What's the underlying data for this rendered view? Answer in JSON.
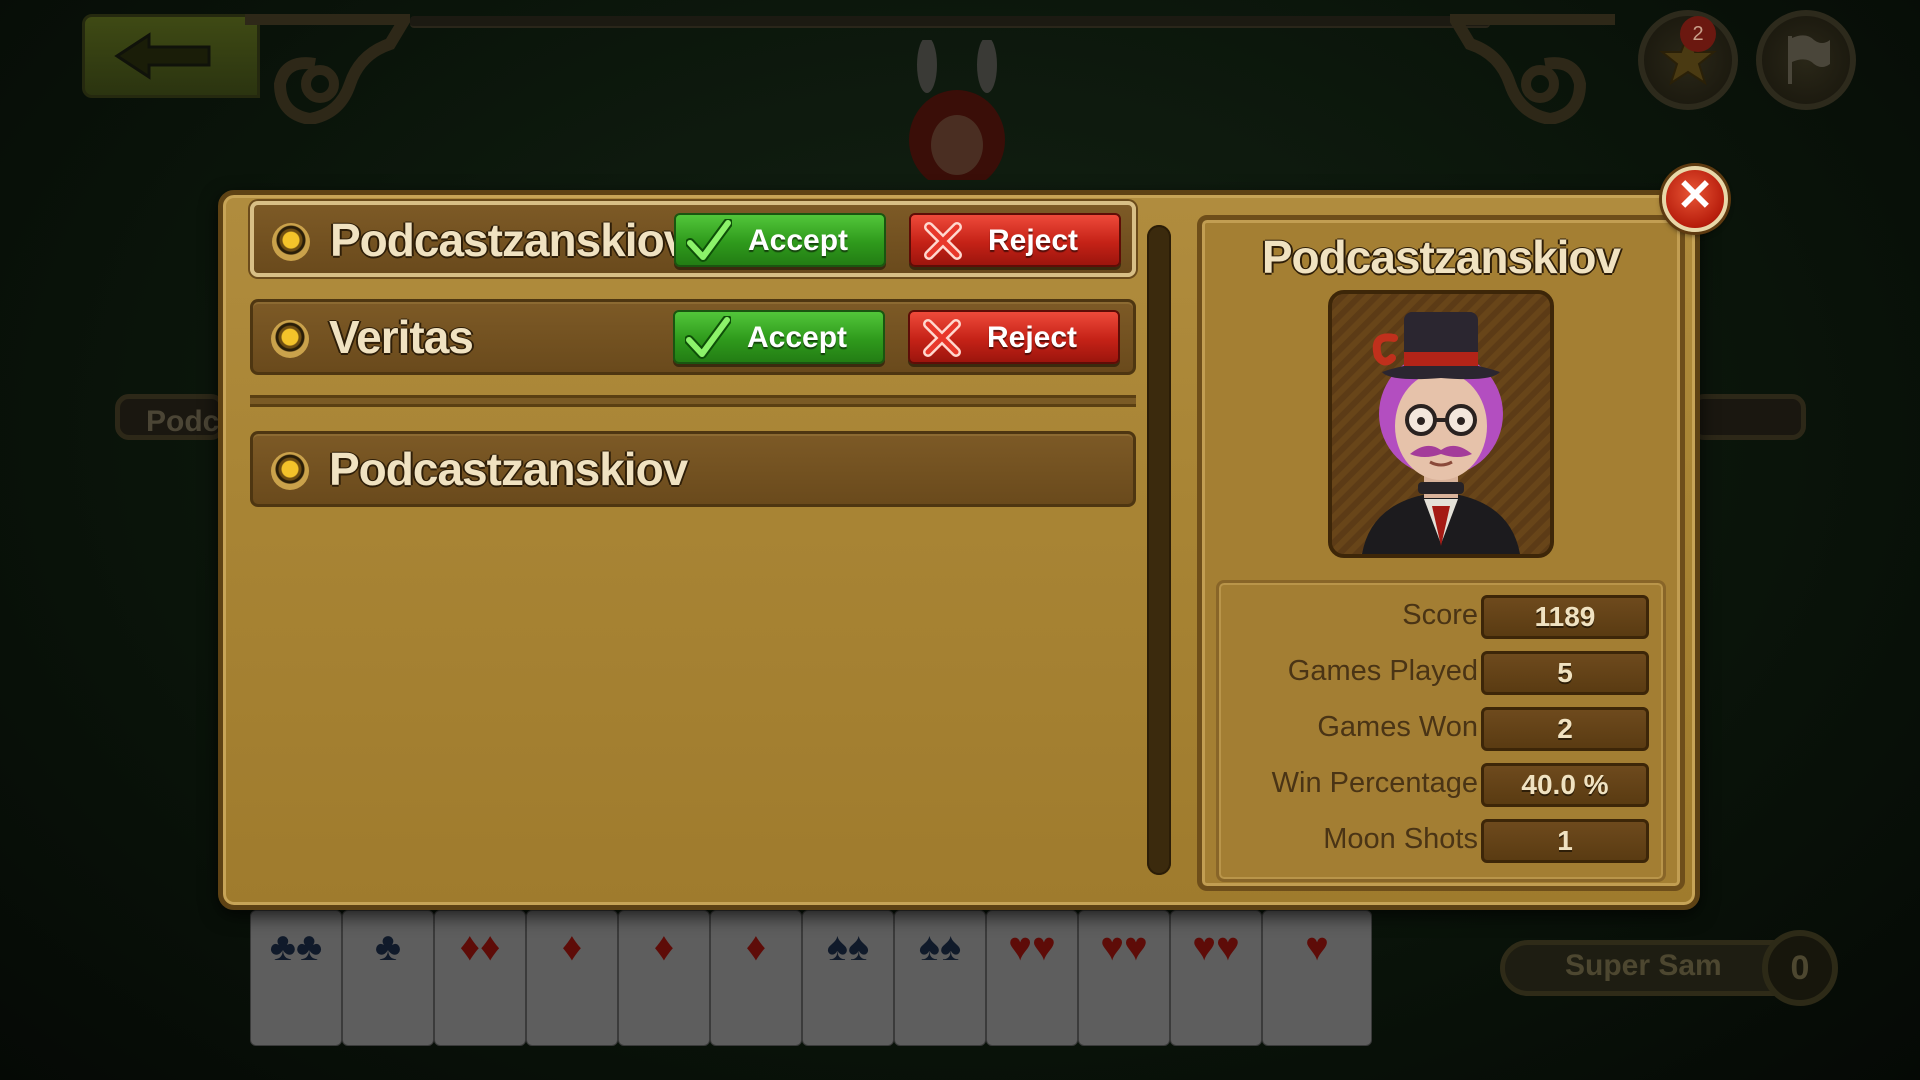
{
  "background": {
    "side_label_left": "Podc",
    "player_plate": {
      "name": "Super Sam",
      "score": "0"
    },
    "notification_count": "2"
  },
  "requests": [
    {
      "name": "Podcastzanskiov",
      "accept_label": "Accept",
      "reject_label": "Reject",
      "selected": true
    },
    {
      "name": "Veritas",
      "accept_label": "Accept",
      "reject_label": "Reject",
      "selected": false
    }
  ],
  "friends": [
    {
      "name": "Podcastzanskiov"
    }
  ],
  "close_label": "✕",
  "profile": {
    "name": "Podcastzanskiov",
    "stats": [
      {
        "label": "Score",
        "value": "1189"
      },
      {
        "label": "Games Played",
        "value": "5"
      },
      {
        "label": "Games Won",
        "value": "2"
      },
      {
        "label": "Win Percentage",
        "value": "40.0 %"
      },
      {
        "label": "Moon Shots",
        "value": "1"
      }
    ]
  },
  "colors": {
    "accept_green": "#2f9a1c",
    "reject_red": "#c52217",
    "panel_gold": "#a98535",
    "row_brown": "#6a4a1c"
  },
  "icons": [
    "back-arrow-icon",
    "star-icon",
    "flag-icon",
    "check-icon",
    "x-icon",
    "close-icon",
    "radio-dot-icon"
  ]
}
